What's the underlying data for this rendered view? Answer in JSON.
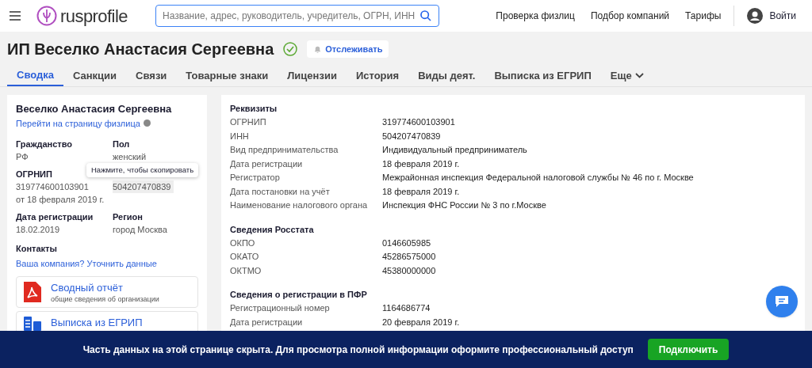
{
  "header": {
    "logo": "rusprofile",
    "search": {
      "placeholder": "Название, адрес, руководитель, учредитель, ОГРН, ИНН"
    },
    "nav": [
      "Проверка физлиц",
      "Подбор компаний",
      "Тарифы"
    ],
    "login": "Войти"
  },
  "title": {
    "text": "ИП Веселко Анастасия Сергеевна",
    "verified": true,
    "follow": "Отслеживать"
  },
  "tabs": [
    {
      "label": "Сводка",
      "selected": true
    },
    {
      "label": "Санкции",
      "selected": false
    },
    {
      "label": "Связи",
      "selected": false
    },
    {
      "label": "Товарные знаки",
      "selected": false
    },
    {
      "label": "Лицензии",
      "selected": false
    },
    {
      "label": "История",
      "selected": false
    },
    {
      "label": "Виды деят.",
      "selected": false
    },
    {
      "label": "Выписка из ЕГРИП",
      "selected": false
    },
    {
      "label": "Еще",
      "selected": false
    }
  ],
  "person": {
    "name": "Веселко Анастасия Сергеевна",
    "link": "Перейти на страницу физлица",
    "fields": [
      {
        "label": "Гражданство",
        "values": [
          "РФ"
        ]
      },
      {
        "label": "Пол",
        "values": [
          "женский"
        ]
      },
      {
        "label": "ОГРНИП",
        "values": [
          "319774600103901",
          "от 18 февраля 2019 г."
        ]
      },
      {
        "values": [
          "504207470839"
        ],
        "tooltip": "Нажмите, чтобы скопировать"
      },
      {
        "label": "Дата регистрации",
        "values": [
          "18.02.2019"
        ]
      },
      {
        "label": "Регион",
        "values": [
          "город Москва"
        ]
      }
    ],
    "contacts": {
      "label": "Контакты",
      "link": "Ваша компания? Уточнить данные"
    },
    "documents": [
      {
        "kind": "pdf",
        "title": "Сводный отчёт",
        "subtitle": "общие сведения об организации"
      },
      {
        "kind": "doc",
        "title": "Выписка из ЕГРИП"
      }
    ]
  },
  "sections": [
    {
      "title": "Реквизиты",
      "rows": [
        [
          "ОГРНИП",
          "319774600103901"
        ],
        [
          "ИНН",
          "504207470839"
        ],
        [
          "Вид предпринимательства",
          "Индивидуальный предприниматель"
        ],
        [
          "Дата регистрации",
          "18 февраля 2019 г."
        ],
        [
          "Регистратор",
          "Межрайонная инспекция Федеральной налоговой службы № 46 по г. Москве"
        ],
        [
          "Дата постановки на учёт",
          "18 февраля 2019 г."
        ],
        [
          "Наименование налогового органа",
          "Инспекция ФНС России № 3 по г.Москве"
        ]
      ]
    },
    {
      "title": "Сведения Росстата",
      "rows": [
        [
          "ОКПО",
          "0146605985"
        ],
        [
          "ОКАТО",
          "45286575000"
        ],
        [
          "ОКТМО",
          "45380000000"
        ]
      ]
    },
    {
      "title": "Сведения о регистрации в ПФР",
      "rows": [
        [
          "Регистрационный номер",
          "1164686774"
        ],
        [
          "Дата регистрации",
          "20 февраля 2019 г."
        ]
      ]
    }
  ],
  "banner": {
    "text": "Часть данных на этой странице скрыта. Для просмотра полной информации оформите профессиональный доступ",
    "button": "Подключить"
  }
}
